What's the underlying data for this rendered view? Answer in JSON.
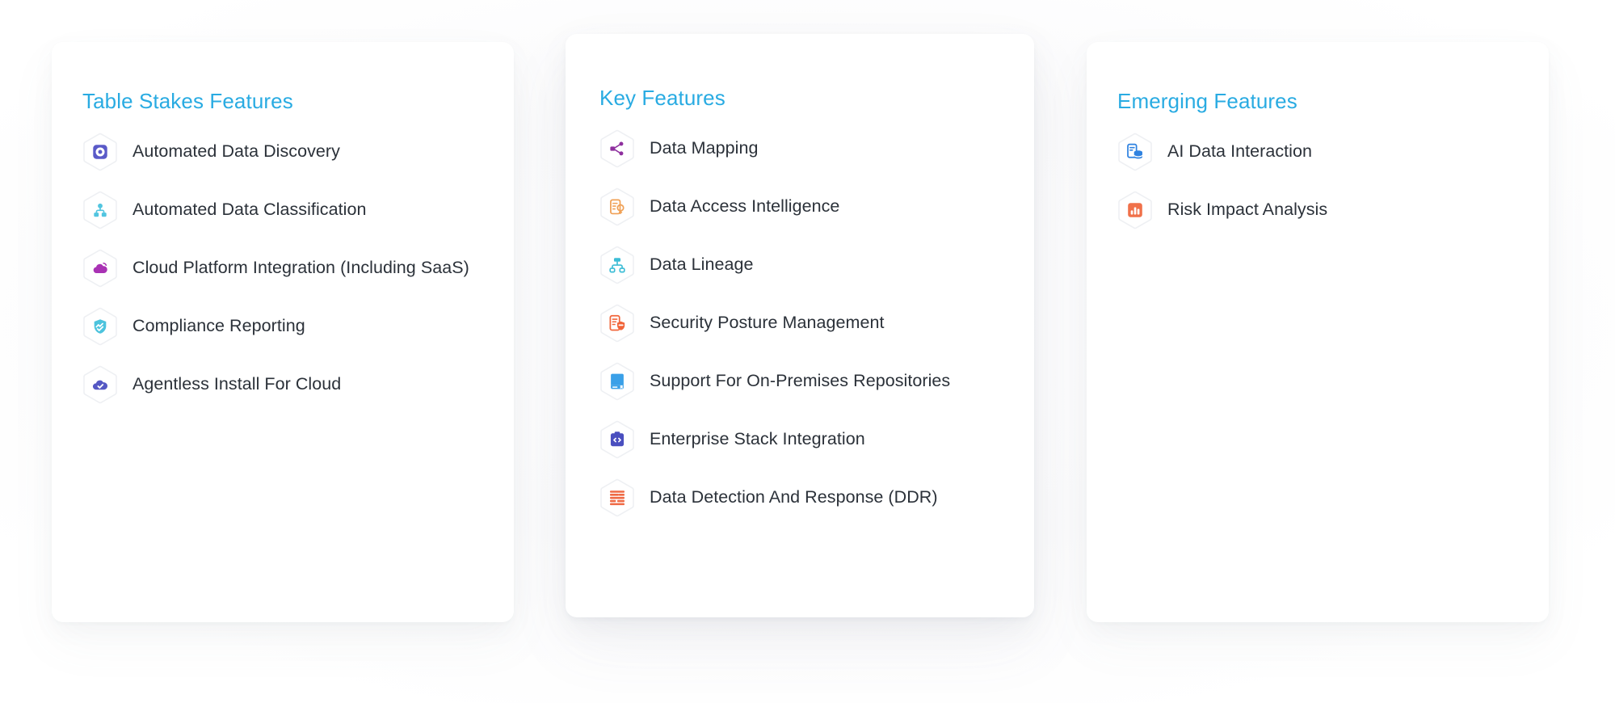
{
  "theme": {
    "page_background": "#ffffff",
    "card_background": "#ffffff",
    "title_color": "#29abe2",
    "label_color": "#2b3139",
    "hex_outline_color": "#eef0f3"
  },
  "columns": [
    {
      "id": "table-stakes",
      "title": "Table Stakes Features",
      "elevated": false,
      "items": [
        {
          "label": "Automated Data Discovery",
          "icon": "data-discovery-icon",
          "icon_color": "#5a5ac8"
        },
        {
          "label": "Automated Data Classification",
          "icon": "data-classification-icon",
          "icon_color": "#52c5e0"
        },
        {
          "label": "Cloud Platform Integration (Including SaaS)",
          "icon": "cloud-platform-icon",
          "icon_color": "#a932b4"
        },
        {
          "label": "Compliance Reporting",
          "icon": "compliance-shield-icon",
          "icon_color": "#4cc3dd"
        },
        {
          "label": "Agentless Install For Cloud",
          "icon": "agentless-cloud-icon",
          "icon_color": "#5558c4"
        }
      ]
    },
    {
      "id": "key-features",
      "title": "Key Features",
      "elevated": true,
      "items": [
        {
          "label": "Data Mapping",
          "icon": "data-mapping-icon",
          "icon_color": "#8e2f9e"
        },
        {
          "label": "Data Access Intelligence",
          "icon": "access-intelligence-icon",
          "icon_color": "#f0a055"
        },
        {
          "label": "Data Lineage",
          "icon": "data-lineage-icon",
          "icon_color": "#3cbdd6"
        },
        {
          "label": "Security Posture Management",
          "icon": "security-posture-icon",
          "icon_color": "#f1653a"
        },
        {
          "label": "Support For On-Premises Repositories",
          "icon": "on-premises-icon",
          "icon_color": "#3aa0e8"
        },
        {
          "label": "Enterprise Stack Integration",
          "icon": "stack-integration-icon",
          "icon_color": "#4a4fbf"
        },
        {
          "label": "Data Detection And Response (DDR)",
          "icon": "ddr-icon",
          "icon_color": "#ef6a45"
        }
      ]
    },
    {
      "id": "emerging-features",
      "title": "Emerging Features",
      "elevated": false,
      "items": [
        {
          "label": "AI Data Interaction",
          "icon": "ai-interaction-icon",
          "icon_color": "#2f82e0"
        },
        {
          "label": "Risk Impact Analysis",
          "icon": "risk-analysis-icon",
          "icon_color": "#f0714a"
        }
      ]
    }
  ]
}
